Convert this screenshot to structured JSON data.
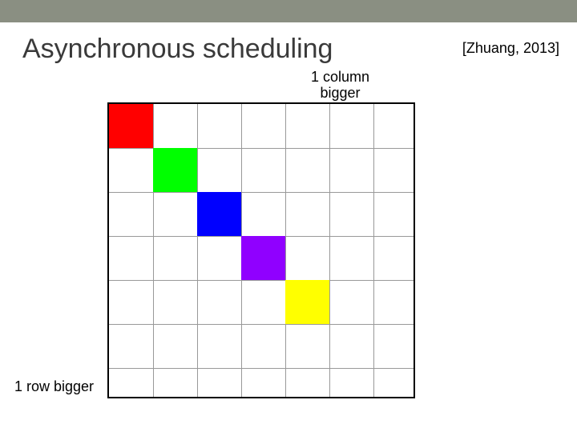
{
  "title": "Asynchronous scheduling",
  "citation": "[Zhuang, 2013]",
  "labels": {
    "column": "1 column\nbigger",
    "row": "1 row bigger"
  },
  "grid": {
    "inner_width": 380,
    "inner_height": 366,
    "regular_col_width": 55,
    "last_col_width": 50,
    "regular_row_height": 55,
    "last_row_height": 36,
    "cols": 7,
    "rows": 7,
    "vline_positions": [
      55,
      110,
      165,
      220,
      275,
      330
    ],
    "hline_positions": [
      55,
      110,
      165,
      220,
      275,
      330
    ]
  },
  "chart_data": {
    "type": "heatmap",
    "title": "Asynchronous scheduling",
    "rows": 7,
    "cols": 7,
    "row_sizes": [
      1,
      1,
      1,
      1,
      1,
      1,
      2
    ],
    "col_sizes": [
      1,
      1,
      1,
      1,
      1,
      1,
      2
    ],
    "colored_cells": [
      {
        "row": 0,
        "col": 0,
        "color": "#ff0000",
        "name": "red"
      },
      {
        "row": 1,
        "col": 1,
        "color": "#00ff00",
        "name": "green"
      },
      {
        "row": 2,
        "col": 2,
        "color": "#0000ff",
        "name": "blue"
      },
      {
        "row": 3,
        "col": 3,
        "color": "#9000ff",
        "name": "purple"
      },
      {
        "row": 4,
        "col": 4,
        "color": "#ffff00",
        "name": "yellow"
      }
    ]
  }
}
